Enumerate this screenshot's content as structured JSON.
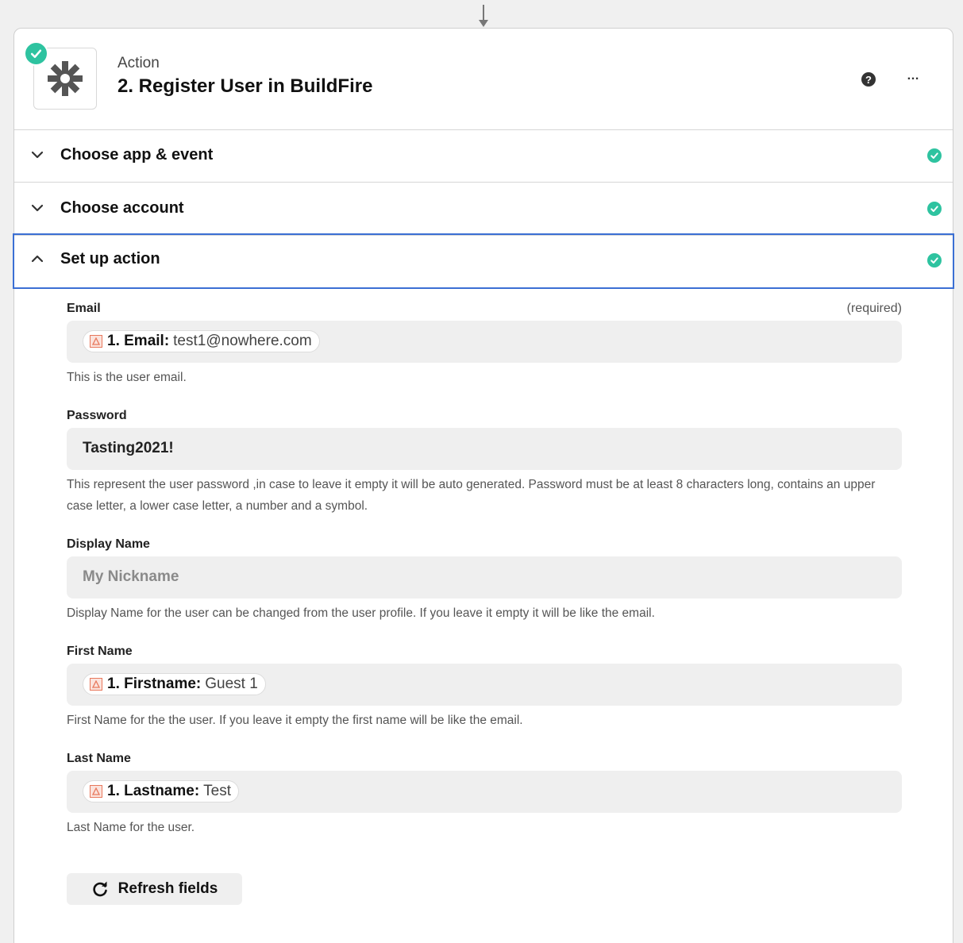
{
  "step": {
    "kind_label": "Action",
    "title": "2. Register User in BuildFire",
    "help_icon": "question-circle-icon",
    "more_icon": "ellipsis-icon",
    "more_label": "…"
  },
  "sections": [
    {
      "label": "Choose app & event",
      "expanded": false,
      "complete": true
    },
    {
      "label": "Choose account",
      "expanded": false,
      "complete": true
    },
    {
      "label": "Set up action",
      "expanded": true,
      "complete": true
    }
  ],
  "form": {
    "email": {
      "label": "Email",
      "required_text": "(required)",
      "token_key": "1. Email:",
      "token_value": "test1@nowhere.com",
      "help": "This is the user email."
    },
    "password": {
      "label": "Password",
      "value": "Tasting2021!",
      "help": "This represent the user password ,in case to leave it empty it will be auto generated. Password must be at least 8 characters long, contains an upper case letter, a lower case letter, a number and a symbol."
    },
    "display_name": {
      "label": "Display Name",
      "placeholder": "My Nickname",
      "help": "Display Name for the user can be changed from the user profile. If you leave it empty it will be like the email."
    },
    "first_name": {
      "label": "First Name",
      "token_key": "1. Firstname:",
      "token_value": "Guest 1",
      "help": "First Name for the the user. If you leave it empty the first name will be like the email."
    },
    "last_name": {
      "label": "Last Name",
      "token_key": "1. Lastname:",
      "token_value": "Test",
      "help": "Last Name for the user."
    }
  },
  "refresh_button": {
    "label": "Refresh fields",
    "icon": "refresh-icon"
  },
  "colors": {
    "success": "#2ec3a0",
    "active_border": "#3b6fd4",
    "token_source": "#e8785c"
  }
}
